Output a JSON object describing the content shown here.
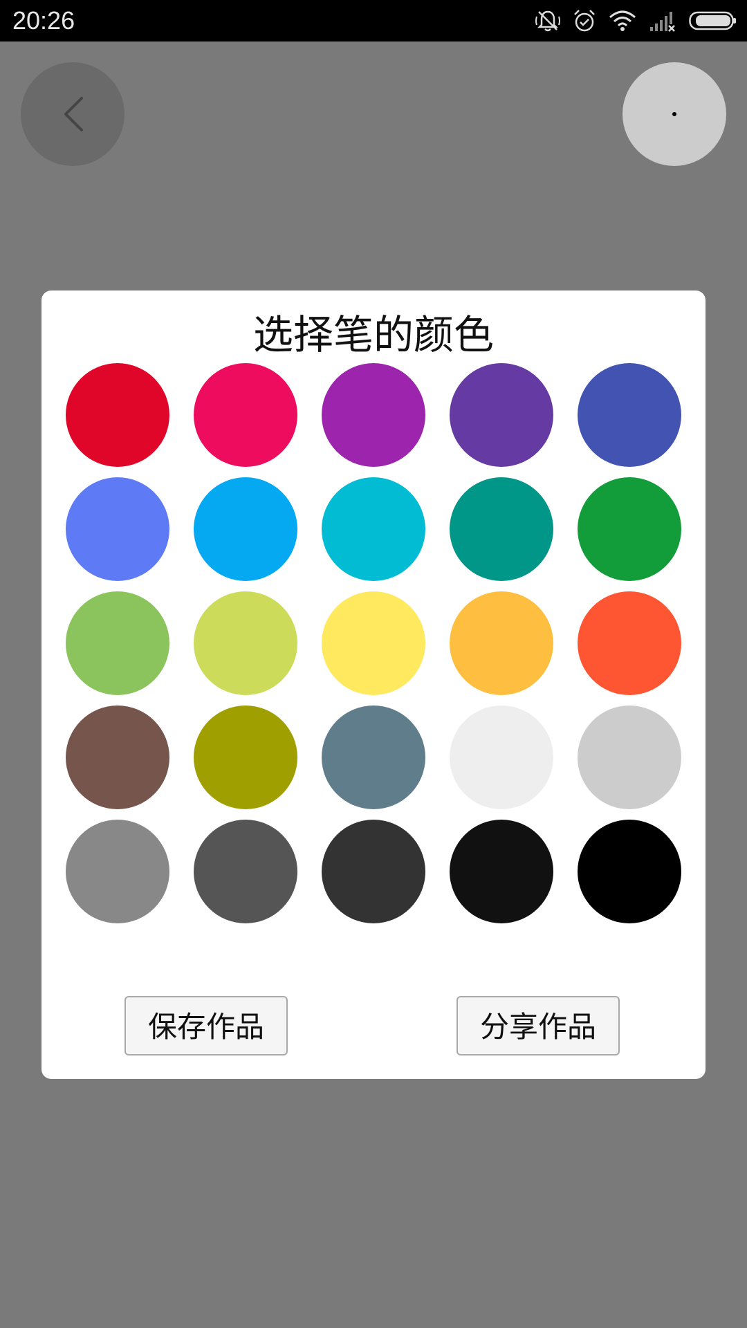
{
  "status_bar": {
    "time": "20:26",
    "icons": [
      "bell-off-icon",
      "alarm-icon",
      "wifi-icon",
      "signal-icon",
      "battery-icon"
    ]
  },
  "top_bar": {
    "back_icon": "chevron-left-icon",
    "brush_preview_color": "#000000"
  },
  "dialog": {
    "title": "选择笔的颜色",
    "colors": [
      "#E0062A",
      "#EE0C5E",
      "#9D24AD",
      "#653AA2",
      "#4353B1",
      "#5E7BF5",
      "#04A9F1",
      "#01BCD3",
      "#019788",
      "#129C3A",
      "#8BC45C",
      "#CCDC5A",
      "#FEE95F",
      "#FEBF40",
      "#FE5533",
      "#75554C",
      "#A09F00",
      "#607D8B",
      "#EEEEEE",
      "#CCCCCC",
      "#888888",
      "#555555",
      "#333333",
      "#111111",
      "#000000"
    ],
    "save_label": "保存作品",
    "share_label": "分享作品"
  }
}
